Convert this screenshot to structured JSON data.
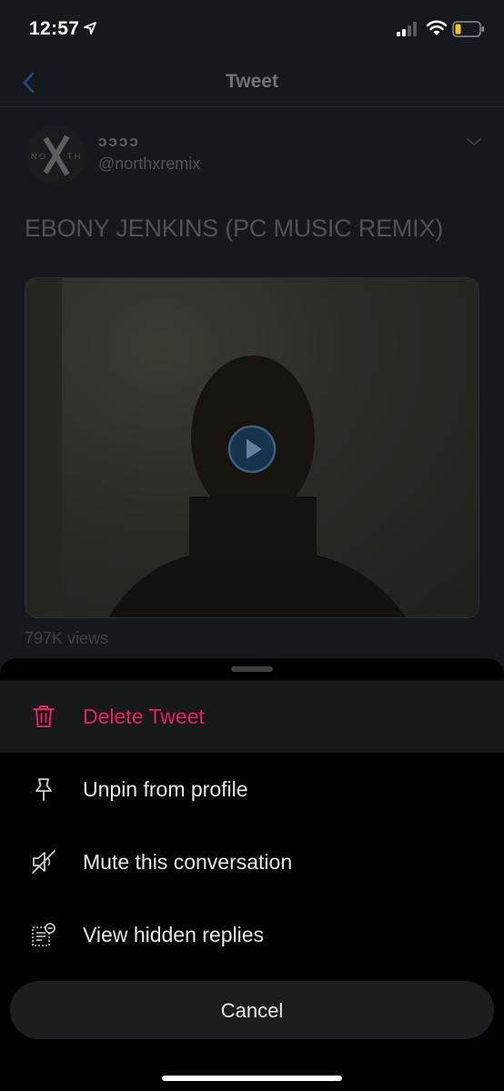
{
  "status_bar": {
    "time": "12:57",
    "icons": [
      "location-arrow-icon",
      "signal-icon",
      "wifi-icon",
      "battery-icon"
    ],
    "battery_color": "#f5c518"
  },
  "nav": {
    "title": "Tweet",
    "back_icon": "chevron-left-icon",
    "accent_color": "#1d9bf0"
  },
  "tweet": {
    "display_name": "ↄↄↄↄ",
    "handle": "@northxremix",
    "avatar_text": "NORTH X S",
    "text": "EBONY JENKINS (PC MUSIC REMIX)",
    "views": "797K views"
  },
  "sheet": {
    "items": [
      {
        "label": "Delete Tweet",
        "icon": "trash-icon",
        "danger": true
      },
      {
        "label": "Unpin from profile",
        "icon": "pin-icon"
      },
      {
        "label": "Mute this conversation",
        "icon": "mute-icon"
      },
      {
        "label": "View hidden replies",
        "icon": "hidden-replies-icon"
      }
    ],
    "cancel_label": "Cancel",
    "danger_color": "#e0245e"
  }
}
